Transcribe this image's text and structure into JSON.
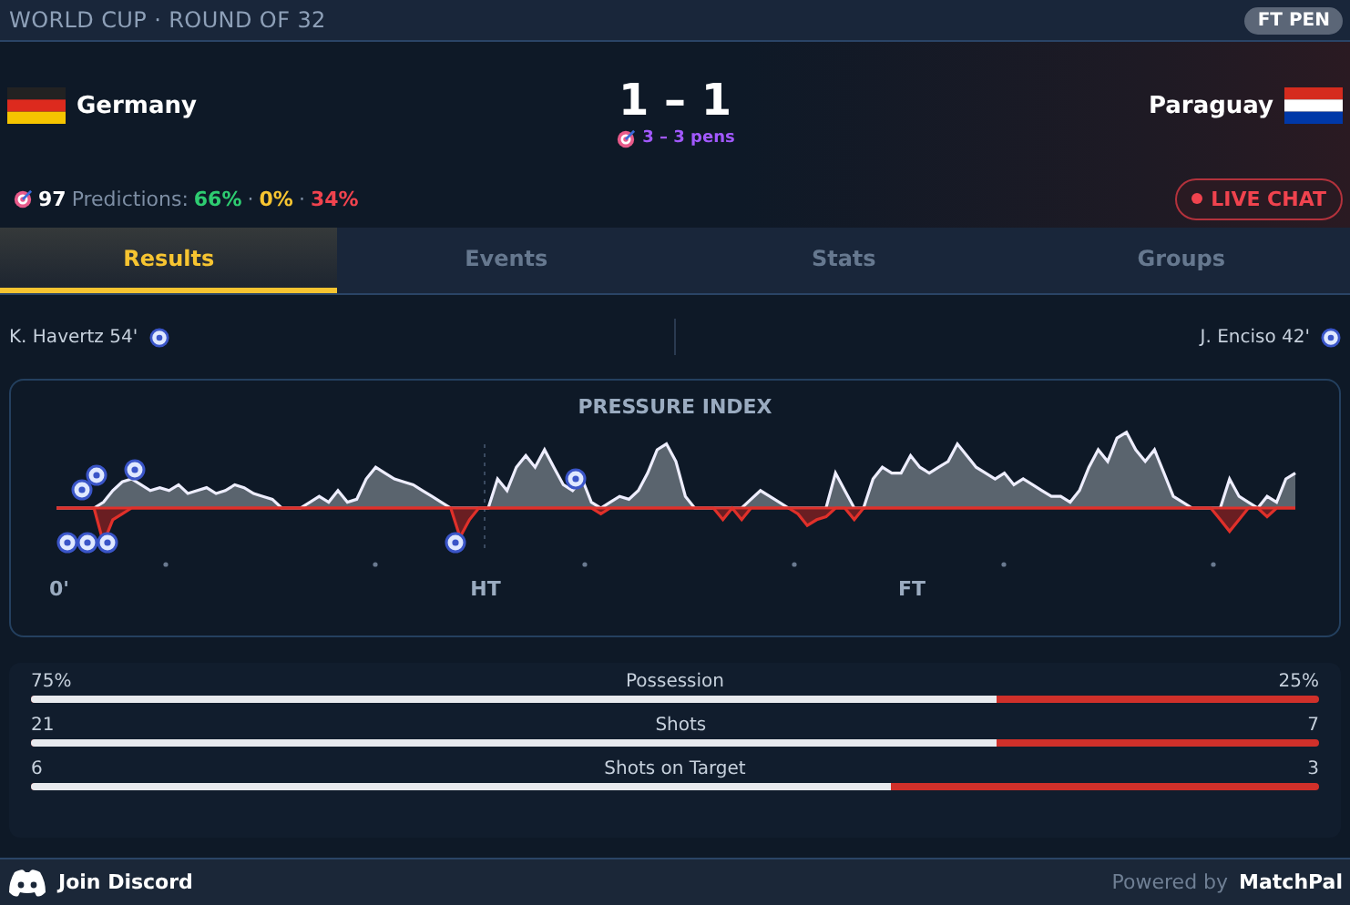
{
  "competition": "WORLD CUP · ROUND OF 32",
  "status_badge": "FT PEN",
  "home": {
    "name": "Germany"
  },
  "away": {
    "name": "Paraguay"
  },
  "score": "1 – 1",
  "penalties": "3 – 3 pens",
  "predictions": {
    "count": "97",
    "label": "Predictions:",
    "home": "66%",
    "draw": "0%",
    "away": "34%",
    "separator": "·"
  },
  "live_chat": "LIVE CHAT",
  "tabs": [
    {
      "label": "Results",
      "selected": true
    },
    {
      "label": "Events",
      "selected": false
    },
    {
      "label": "Stats",
      "selected": false
    },
    {
      "label": "Groups",
      "selected": false
    }
  ],
  "scorers": {
    "home": "K. Havertz 54'",
    "away": "J. Enciso 42'"
  },
  "pressure": {
    "title": "PRESSURE INDEX",
    "labels": [
      "0'",
      "HT",
      "FT"
    ]
  },
  "stats": [
    {
      "home": "75%",
      "label": "Possession",
      "away": "25%",
      "level": 0.75
    },
    {
      "home": "21",
      "label": "Shots",
      "away": "7",
      "level": 0.75
    },
    {
      "home": "6",
      "label": "Shots on Target",
      "away": "3",
      "level": 0.667
    }
  ],
  "footer": {
    "discord": "Join Discord",
    "powered": "Powered by",
    "brand": "MatchPal"
  }
}
